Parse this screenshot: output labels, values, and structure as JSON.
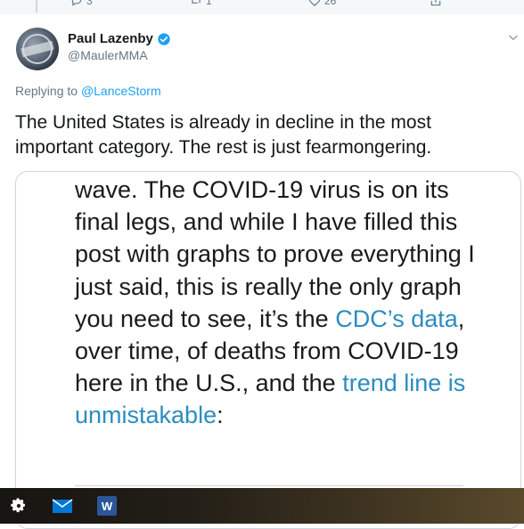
{
  "previous_tweet": {
    "reply_count": "3",
    "retweet_count": "1",
    "like_count": "26"
  },
  "tweet": {
    "display_name": "Paul Lazenby",
    "handle": "@MaulerMMA",
    "verified": true,
    "replying_prefix": "Replying to ",
    "replying_to": "@LanceStorm",
    "text": "The United States is already in decline in the most important category. The rest is just fearmongering."
  },
  "card": {
    "t1": "wave. The COVID-19 virus is on its final legs, and while I have filled this post with graphs to prove everything I just said, this is really the only graph you need to see, it’s the ",
    "link1": "CDC’s data",
    "t2": ", over time, of deaths from COVID-19 here in the U.S., and the ",
    "link2": "trend line is unmistakable",
    "t3": ":"
  },
  "colors": {
    "link": "#1da1f2",
    "card_link": "#2c8cc0",
    "verified": "#1da1f2",
    "secondary_text": "#657786"
  },
  "taskbar": {
    "items": [
      "settings-icon",
      "mail-icon",
      "word-icon"
    ],
    "word_letter": "W"
  }
}
